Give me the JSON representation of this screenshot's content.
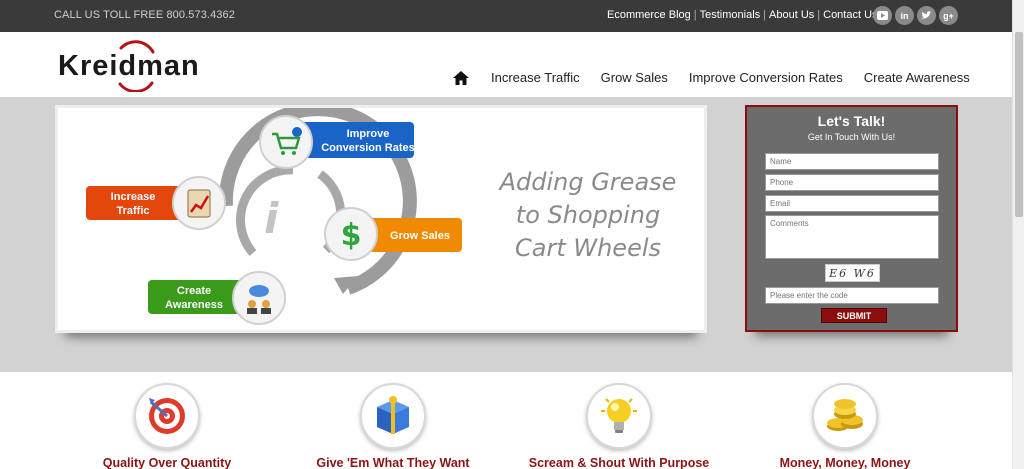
{
  "topbar": {
    "phone": "CALL US TOLL FREE 800.573.4362",
    "links": [
      "Ecommerce Blog",
      "Testimonials",
      "About Us",
      "Contact Us"
    ],
    "social_icons": [
      "youtube-icon",
      "linkedin-icon",
      "twitter-icon",
      "google-plus-icon"
    ]
  },
  "header": {
    "logo_text": "Kreidman",
    "nav": [
      "Increase Traffic",
      "Grow Sales",
      "Improve Conversion Rates",
      "Create Awareness"
    ]
  },
  "hero": {
    "diagram": {
      "improve_line1": "Improve",
      "improve_line2": "Conversion Rates",
      "traffic_line1": "Increase",
      "traffic_line2": "Traffic",
      "sales": "Grow Sales",
      "aware_line1": "Create",
      "aware_line2": "Awareness",
      "center_glyph": "i"
    },
    "tagline": [
      "Adding Grease",
      "to Shopping",
      "Cart Wheels"
    ]
  },
  "contact_form": {
    "title": "Let's Talk!",
    "subtitle": "Get In Touch With Us!",
    "name_placeholder": "Name",
    "phone_placeholder": "Phone",
    "email_placeholder": "Email",
    "comments_placeholder": "Comments",
    "captcha_text": "E6 W6",
    "code_placeholder": "Please enter the code",
    "submit_label": "SUBMIT"
  },
  "features": [
    {
      "title": "Quality Over Quantity",
      "icon": "target-icon"
    },
    {
      "title": "Give 'Em What They Want",
      "icon": "gift-box-icon"
    },
    {
      "title": "Scream & Shout With Purpose",
      "icon": "light-bulb-icon"
    },
    {
      "title": "Money, Money, Money",
      "icon": "gold-coins-icon"
    }
  ],
  "colors": {
    "topbar": "#3a3a3a",
    "accent_red": "#8b0e0e",
    "hero_bg": "#d2d2d2",
    "blue_badge": "#1a64c8",
    "orange_badge": "#f08a00",
    "green_badge": "#3a9a1a",
    "red_badge": "#e4470c"
  }
}
